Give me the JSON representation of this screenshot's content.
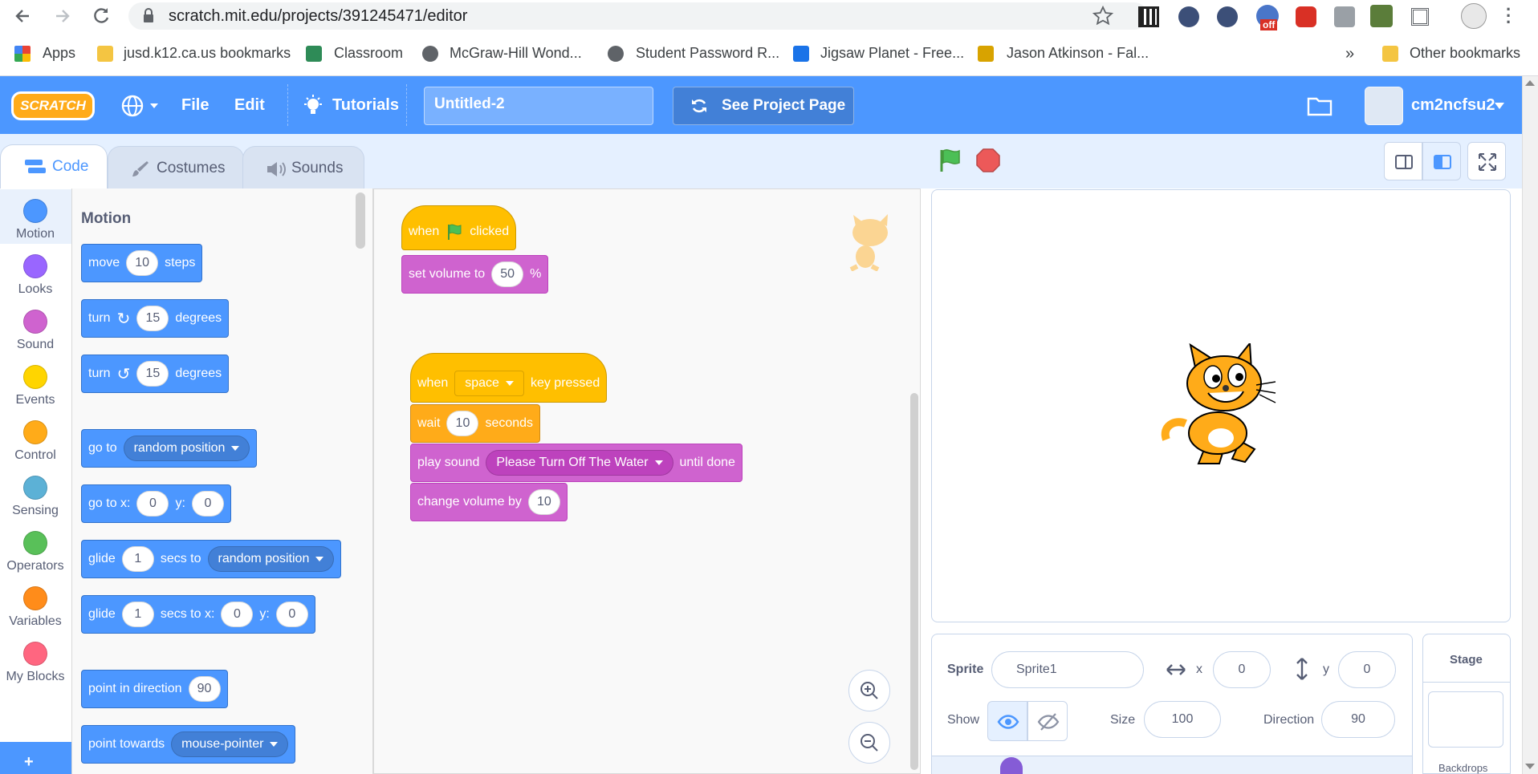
{
  "browser": {
    "url": "scratch.mit.edu/projects/391245471/editor",
    "bookmarks": [
      "Apps",
      "jusd.k12.ca.us bookmarks",
      "Classroom",
      "McGraw-Hill Wond...",
      "Student Password R...",
      "Jigsaw Planet - Free...",
      "Jason Atkinson - Fal...",
      "Other bookmarks"
    ],
    "overflow": "»",
    "ext_badge": "off"
  },
  "menubar": {
    "logo": "SCRATCH",
    "file": "File",
    "edit": "Edit",
    "tutorials": "Tutorials",
    "project_title": "Untitled-2",
    "see_project": "See Project Page",
    "username": "cm2ncfsu2"
  },
  "tabs": {
    "code": "Code",
    "costumes": "Costumes",
    "sounds": "Sounds"
  },
  "categories": [
    {
      "label": "Motion",
      "color": "#4c97ff"
    },
    {
      "label": "Looks",
      "color": "#9966ff"
    },
    {
      "label": "Sound",
      "color": "#cf63cf"
    },
    {
      "label": "Events",
      "color": "#ffd500"
    },
    {
      "label": "Control",
      "color": "#ffab19"
    },
    {
      "label": "Sensing",
      "color": "#5cb1d6"
    },
    {
      "label": "Operators",
      "color": "#59c059"
    },
    {
      "label": "Variables",
      "color": "#ff8c1a"
    },
    {
      "label": "My Blocks",
      "color": "#ff6680"
    }
  ],
  "palette": {
    "heading": "Motion",
    "move": {
      "a": "move",
      "v": "10",
      "b": "steps"
    },
    "turn_cw": {
      "a": "turn",
      "v": "15",
      "b": "degrees"
    },
    "turn_ccw": {
      "a": "turn",
      "v": "15",
      "b": "degrees"
    },
    "goto": {
      "a": "go to",
      "d": "random position"
    },
    "gotoxy": {
      "a": "go to x:",
      "x": "0",
      "b": "y:",
      "y": "0"
    },
    "glide_to": {
      "a": "glide",
      "v": "1",
      "b": "secs to",
      "d": "random position"
    },
    "glide_xy": {
      "a": "glide",
      "v": "1",
      "b": "secs to x:",
      "x": "0",
      "c": "y:",
      "y": "0"
    },
    "point_dir": {
      "a": "point in direction",
      "v": "90"
    },
    "point_towards": {
      "a": "point towards",
      "d": "mouse-pointer"
    }
  },
  "scripts": {
    "when_flag": {
      "a": "when",
      "b": "clicked"
    },
    "set_volume": {
      "a": "set volume to",
      "v": "50",
      "b": "%"
    },
    "when_key": {
      "a": "when",
      "d": "space",
      "b": "key pressed"
    },
    "wait": {
      "a": "wait",
      "v": "10",
      "b": "seconds"
    },
    "play_sound": {
      "a": "play sound",
      "d": "Please Turn Off The Water",
      "b": "until done"
    },
    "change_volume": {
      "a": "change volume by",
      "v": "10"
    }
  },
  "sprite_info": {
    "sprite_label": "Sprite",
    "sprite_name": "Sprite1",
    "x_label": "x",
    "x": "0",
    "y_label": "y",
    "y": "0",
    "show_label": "Show",
    "size_label": "Size",
    "size": "100",
    "direction_label": "Direction",
    "direction": "90"
  },
  "stage_pane": {
    "title": "Stage",
    "backdrops": "Backdrops"
  }
}
